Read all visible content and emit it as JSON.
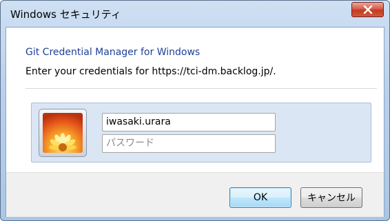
{
  "window": {
    "title": "Windows セキュリティ",
    "close_symbol": "X"
  },
  "header": {
    "app_name": "Git Credential Manager for Windows",
    "message": "Enter your credentials for https://tci-dm.backlog.jp/."
  },
  "credentials": {
    "avatar_icon": "flower-user-tile-icon",
    "username_value": "iwasaki.urara",
    "password_placeholder": "パスワード"
  },
  "buttons": {
    "ok_label": "OK",
    "cancel_label": "キャンセル"
  },
  "colors": {
    "header_text": "#1e3f99",
    "close_button": "#c13b22",
    "panel_background": "#dbe6f4"
  }
}
